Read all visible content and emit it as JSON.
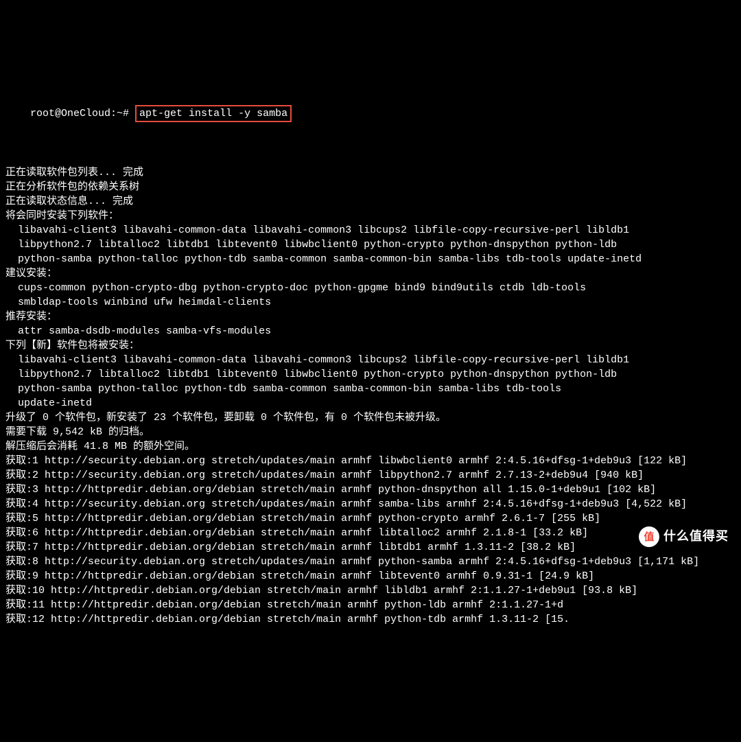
{
  "prompt": "root@OneCloud:~# ",
  "command": "apt-get install -y samba",
  "lines": [
    "正在读取软件包列表... 完成",
    "正在分析软件包的依赖关系树",
    "正在读取状态信息... 完成",
    "将会同时安装下列软件：",
    "  libavahi-client3 libavahi-common-data libavahi-common3 libcups2 libfile-copy-recursive-perl libldb1",
    "  libpython2.7 libtalloc2 libtdb1 libtevent0 libwbclient0 python-crypto python-dnspython python-ldb",
    "  python-samba python-talloc python-tdb samba-common samba-common-bin samba-libs tdb-tools update-inetd",
    "建议安装：",
    "  cups-common python-crypto-dbg python-crypto-doc python-gpgme bind9 bind9utils ctdb ldb-tools",
    "  smbldap-tools winbind ufw heimdal-clients",
    "推荐安装：",
    "  attr samba-dsdb-modules samba-vfs-modules",
    "下列【新】软件包将被安装：",
    "  libavahi-client3 libavahi-common-data libavahi-common3 libcups2 libfile-copy-recursive-perl libldb1",
    "  libpython2.7 libtalloc2 libtdb1 libtevent0 libwbclient0 python-crypto python-dnspython python-ldb",
    "  python-samba python-talloc python-tdb samba-common samba-common-bin samba-libs tdb-tools",
    "  update-inetd",
    "升级了 0 个软件包，新安装了 23 个软件包，要卸载 0 个软件包，有 0 个软件包未被升级。",
    "需要下载 9,542 kB 的归档。",
    "解压缩后会消耗 41.8 MB 的额外空间。",
    "获取:1 http://security.debian.org stretch/updates/main armhf libwbclient0 armhf 2:4.5.16+dfsg-1+deb9u3 [122 kB]",
    "获取:2 http://security.debian.org stretch/updates/main armhf libpython2.7 armhf 2.7.13-2+deb9u4 [940 kB]",
    "获取:3 http://httpredir.debian.org/debian stretch/main armhf python-dnspython all 1.15.0-1+deb9u1 [102 kB]",
    "获取:4 http://security.debian.org stretch/updates/main armhf samba-libs armhf 2:4.5.16+dfsg-1+deb9u3 [4,522 kB]",
    "获取:5 http://httpredir.debian.org/debian stretch/main armhf python-crypto armhf 2.6.1-7 [255 kB]",
    "获取:6 http://httpredir.debian.org/debian stretch/main armhf libtalloc2 armhf 2.1.8-1 [33.2 kB]",
    "获取:7 http://httpredir.debian.org/debian stretch/main armhf libtdb1 armhf 1.3.11-2 [38.2 kB]",
    "获取:8 http://security.debian.org stretch/updates/main armhf python-samba armhf 2:4.5.16+dfsg-1+deb9u3 [1,171 kB]",
    "获取:9 http://httpredir.debian.org/debian stretch/main armhf libtevent0 armhf 0.9.31-1 [24.9 kB]",
    "获取:10 http://httpredir.debian.org/debian stretch/main armhf libldb1 armhf 2:1.1.27-1+deb9u1 [93.8 kB]",
    "获取:11 http://httpredir.debian.org/debian stretch/main armhf python-ldb armhf 2:1.1.27-1+d",
    "获取:12 http://httpredir.debian.org/debian stretch/main armhf python-tdb armhf 1.3.11-2 [15."
  ],
  "watermark": {
    "badge": "值",
    "text": "什么值得买"
  }
}
